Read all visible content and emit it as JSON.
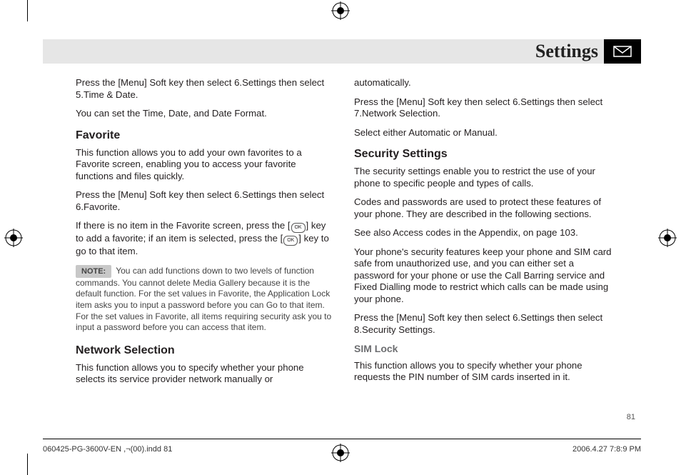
{
  "header": {
    "title": "Settings",
    "icon_name": "envelope-icon"
  },
  "left_col": {
    "intro_p1": "Press the [Menu] Soft key then select 6.Settings then select 5.Time & Date.",
    "intro_p2": "You can set the Time, Date, and Date Format.",
    "favorite_heading": "Favorite",
    "favorite_p1": "This function allows you to add your own favorites to a Favorite screen, enabling you to access your favorite functions and files quickly.",
    "favorite_p2": "Press the [Menu] Soft key then select 6.Settings then select 6.Favorite.",
    "favorite_p3a": "If there is no item in the Favorite screen, press the [",
    "favorite_p3b": "] key to add a favorite; if an item is selected, press the [",
    "favorite_p3c": "] key to go to that item.",
    "note_label": "NOTE:",
    "note_text": "You can add functions down to two levels of function commands. You cannot delete Media Gallery because it is the default function. For the set values in Favorite, the Application Lock item asks you to input a password before you can Go to that item. For the set values in Favorite, all items requiring security ask you to input a password before you can access that item.",
    "network_heading": "Network Selection",
    "network_p1": "This function allows you to specify whether your phone selects its service provider network manually or"
  },
  "right_col": {
    "cont_p1": "automatically.",
    "cont_p2": "Press the [Menu] Soft key then select 6.Settings then select 7.Network Selection.",
    "cont_p3": "Select either Automatic or Manual.",
    "security_heading": "Security Settings",
    "security_p1": "The security settings enable you to restrict the use of your phone to specific people and types of calls.",
    "security_p2": "Codes and passwords are used to protect these features of your phone. They are described in the following sections.",
    "security_p3": "See also Access codes in the Appendix, on page 103.",
    "security_p4": "Your phone's security features keep your phone and SIM card safe from unauthorized use, and you can either set a password for your phone or use the Call Barring service and Fixed Dialling mode to restrict which calls can be made using your phone.",
    "security_p5": "Press the [Menu] Soft key then select 6.Settings then select 8.Security Settings.",
    "simlock_heading": "SIM Lock",
    "simlock_p1": "This function allows you to specify whether your phone requests the PIN number of SIM cards inserted in it."
  },
  "page_number": "81",
  "footer": {
    "left": "060425-PG-3600V-EN ,¬(00).indd   81",
    "right": "2006.4.27   7:8:9 PM"
  },
  "ok_glyph": "OK"
}
